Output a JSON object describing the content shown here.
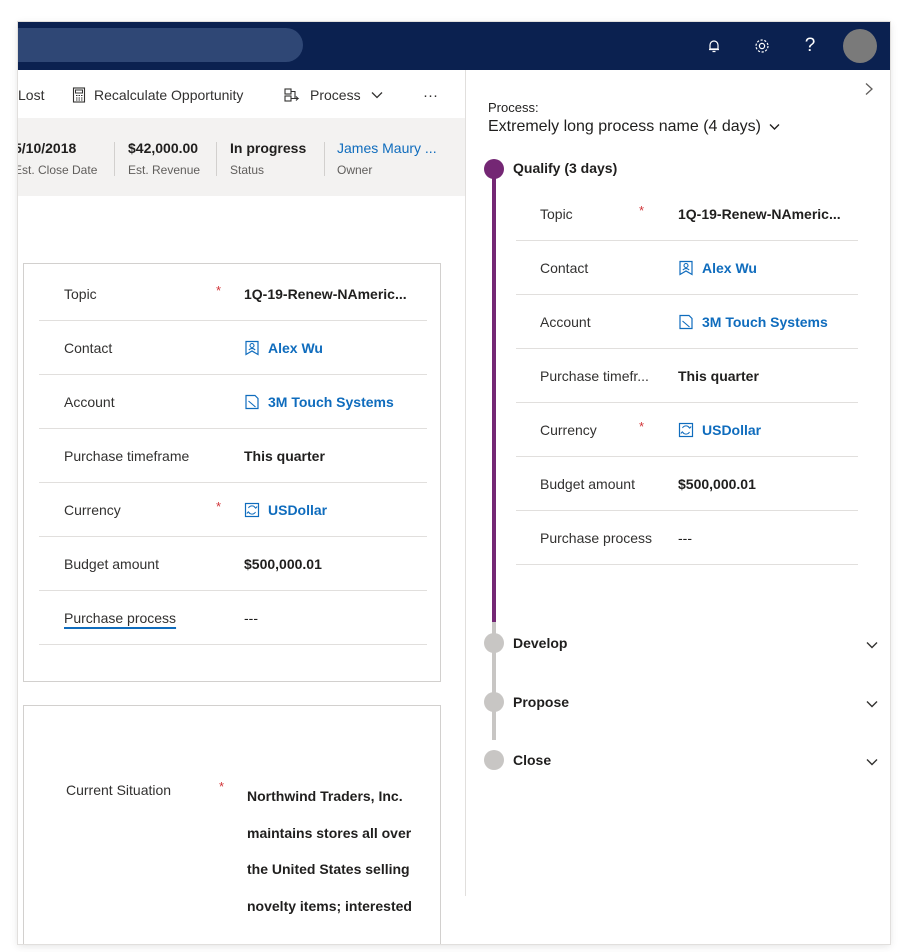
{
  "commandbar": {
    "lost_label": "Lost",
    "recalculate_label": "Recalculate Opportunity",
    "process_label": "Process",
    "more_label": "···"
  },
  "header": {
    "close_date": "5/10/2018",
    "close_date_label": "Est. Close Date",
    "revenue": "$42,000.00",
    "revenue_label": "Est. Revenue",
    "status": "In progress",
    "status_label": "Status",
    "owner": "James Maury ...",
    "owner_label": "Owner"
  },
  "form": {
    "rows": [
      {
        "label": "Topic",
        "value": "1Q-19-Renew-NAmeric...",
        "required": true
      },
      {
        "label": "Contact",
        "value": "Alex Wu",
        "icon": "contact-icon"
      },
      {
        "label": "Account",
        "value": "3M Touch Systems",
        "icon": "account-icon"
      },
      {
        "label": "Purchase timeframe",
        "value": "This quarter"
      },
      {
        "label": "Currency",
        "value": "USDollar",
        "required": true,
        "icon": "currency-icon"
      },
      {
        "label": "Budget amount",
        "value": "$500,000.01"
      },
      {
        "label": "Purchase process",
        "value": "---"
      }
    ],
    "required_mark": "*"
  },
  "situation": {
    "label": "Current Situation",
    "value": "Northwind Traders, Inc. maintains stores all over the United States selling novelty items; interested"
  },
  "process_panel": {
    "label": "Process:",
    "name": "Extremely long process name (4 days)",
    "active_stage": "Qualify (3 days)",
    "fields": [
      {
        "label": "Topic",
        "value": "1Q-19-Renew-NAmeric...",
        "required": true
      },
      {
        "label": "Contact",
        "value": "Alex Wu",
        "icon": "contact-icon"
      },
      {
        "label": "Account",
        "value": "3M Touch Systems",
        "icon": "account-icon"
      },
      {
        "label": "Purchase timefr...",
        "value": "This quarter"
      },
      {
        "label": "Currency",
        "value": "USDollar",
        "required": true,
        "icon": "currency-icon"
      },
      {
        "label": "Budget amount",
        "value": "$500,000.01"
      },
      {
        "label": "Purchase process",
        "value": "---"
      }
    ],
    "stages": [
      "Develop",
      "Propose",
      "Close"
    ]
  },
  "colors": {
    "topbar": "#0b2150",
    "accent_purple": "#742774",
    "link_blue": "#0f6cbd",
    "required_red": "#d13438"
  }
}
